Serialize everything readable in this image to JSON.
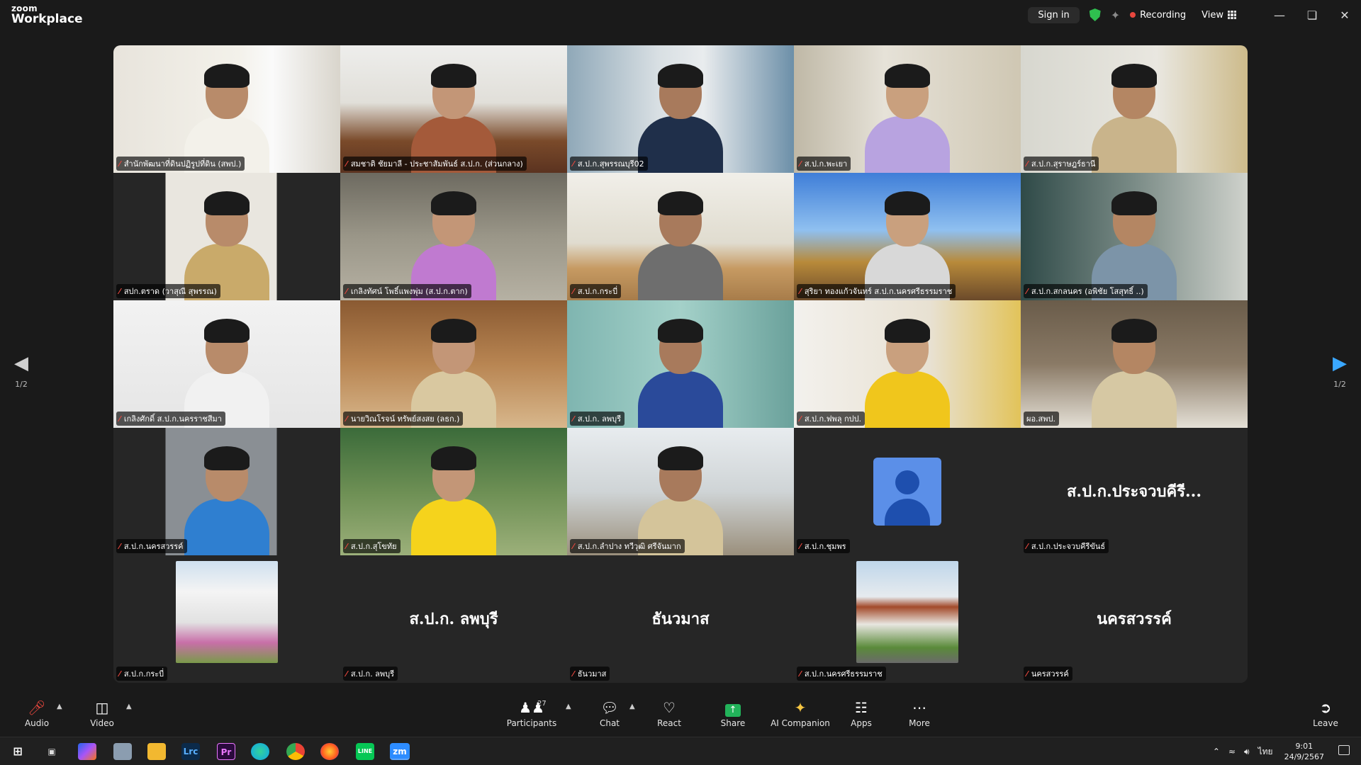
{
  "app": {
    "logo_top": "zoom",
    "logo_bottom": "Workplace",
    "sign_in": "Sign in",
    "recording": "Recording",
    "view": "View"
  },
  "colors": {
    "active_speaker_border": "#22c55e",
    "muted_mic": "#e8473e",
    "share_green": "#22b35a",
    "avatar_blue": "#5b8fe8"
  },
  "gallery": {
    "page_indicator_left": "1/2",
    "page_indicator_right": "1/2",
    "tiles": [
      {
        "name": "สำนักพัฒนาที่ดินปฏิรูปที่ดิน (สพป.)",
        "muted": true,
        "kind": "video"
      },
      {
        "name": "สมชาติ ชัยมาลี - ประชาสัมพันธ์ ส.ป.ก. (ส่วนกลาง)",
        "muted": true,
        "kind": "video"
      },
      {
        "name": "ส.ป.ก.สุพรรณบุรี02",
        "muted": true,
        "kind": "video"
      },
      {
        "name": "ส.ป.ก.พะเยา",
        "muted": true,
        "kind": "video"
      },
      {
        "name": "ส.ป.ก.สุราษฎร์ธานี",
        "muted": true,
        "kind": "video"
      },
      {
        "name": "สปก.ตราด (วาสุณี สุพรรณ)",
        "muted": true,
        "kind": "video"
      },
      {
        "name": "เกลิงทัศน์ โพธิ์แพงพุ่ม (ส.ป.ก.ตาก)",
        "muted": true,
        "kind": "video"
      },
      {
        "name": "ส.ป.ก.กระบี่",
        "muted": true,
        "kind": "video"
      },
      {
        "name": "สุริยา ทองแก้วจันทร์ ส.ป.ก.นครศรีธรรมราช",
        "muted": true,
        "kind": "video"
      },
      {
        "name": "ส.ป.ก.สกลนคร (อพิชัย โสสุทธิ์ ..)",
        "muted": true,
        "kind": "video"
      },
      {
        "name": "เกลิงศักดิ์ ส.ป.ก.นครราชสีมา",
        "muted": true,
        "kind": "video"
      },
      {
        "name": "นายวิณโรจน์ ทรัพย์สงสย (ลธก.)",
        "muted": true,
        "kind": "video"
      },
      {
        "name": "ส.ป.ก. ลพบุรี",
        "muted": true,
        "kind": "video"
      },
      {
        "name": "ส.ป.ก.ฟพลุ กปป.",
        "muted": true,
        "kind": "video"
      },
      {
        "name": "ผอ.สพป.",
        "muted": false,
        "kind": "video",
        "active": true
      },
      {
        "name": "ส.ป.ก.นครสวรรค์",
        "muted": true,
        "kind": "video"
      },
      {
        "name": "ส.ป.ก.สุโขทัย",
        "muted": true,
        "kind": "video"
      },
      {
        "name": "ส.ป.ก.ลำปาง ทวีวุฒิ ศรีจันมาก",
        "muted": true,
        "kind": "video"
      },
      {
        "name": "ส.ป.ก.ชุมพร",
        "muted": true,
        "kind": "avatar"
      },
      {
        "name": "ส.ป.ก.ประจวบคีรีขันธ์",
        "muted": true,
        "kind": "text",
        "display": "ส.ป.ก.ประจวบคีรี..."
      },
      {
        "name": "ส.ป.ก.กระบี่",
        "muted": true,
        "kind": "photo"
      },
      {
        "name": "ส.ป.ก. ลพบุรี",
        "muted": true,
        "kind": "text",
        "display": "ส.ป.ก. ลพบุรี"
      },
      {
        "name": "ธันวมาส",
        "muted": true,
        "kind": "text",
        "display": "ธันวมาส"
      },
      {
        "name": "ส.ป.ก.นครศรีธรรมราช",
        "muted": true,
        "kind": "photo"
      },
      {
        "name": "นครสวรรค์",
        "muted": true,
        "kind": "text",
        "display": "นครสวรรค์"
      }
    ]
  },
  "toolbar": {
    "audio": "Audio",
    "video": "Video",
    "participants": "Participants",
    "participants_count": "27",
    "chat": "Chat",
    "react": "React",
    "share": "Share",
    "ai_companion": "AI Companion",
    "apps": "Apps",
    "more": "More",
    "leave": "Leave"
  },
  "taskbar": {
    "apps": [
      "start",
      "task-view",
      "copilot",
      "files",
      "explorer",
      "lrc",
      "pr",
      "edge",
      "chrome",
      "firefox",
      "line",
      "zoom"
    ],
    "lrc_label": "Lrc",
    "pr_label": "Pr",
    "zoom_label": "zm",
    "line_label": "LINE",
    "lang": "ไทย",
    "time": "9:01",
    "date": "24/9/2567"
  }
}
